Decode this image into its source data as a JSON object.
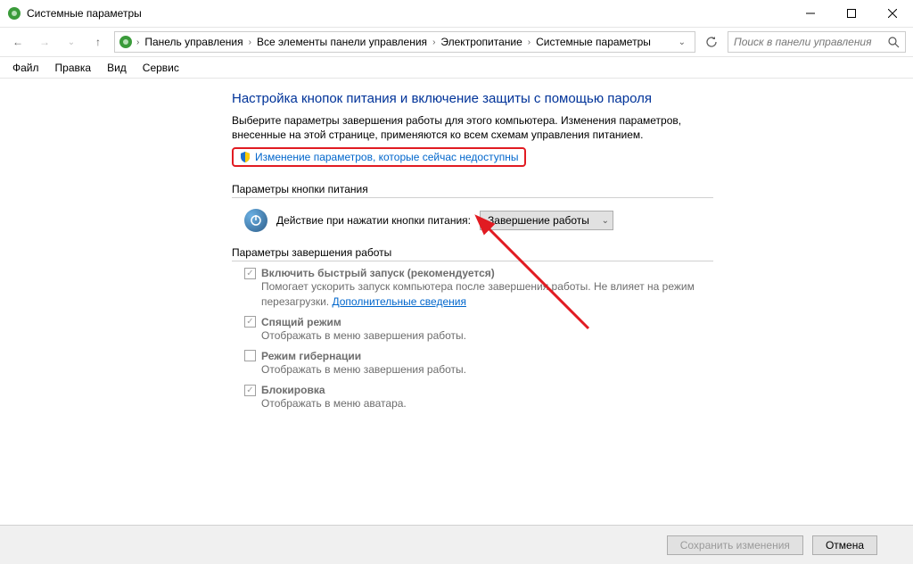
{
  "window": {
    "title": "Системные параметры"
  },
  "breadcrumb": {
    "items": [
      "Панель управления",
      "Все элементы панели управления",
      "Электропитание",
      "Системные параметры"
    ]
  },
  "search": {
    "placeholder": "Поиск в панели управления"
  },
  "menu": {
    "file": "Файл",
    "edit": "Правка",
    "view": "Вид",
    "service": "Сервис"
  },
  "page": {
    "heading": "Настройка кнопок питания и включение защиты с помощью пароля",
    "description": "Выберите параметры завершения работы для этого компьютера. Изменения параметров, внесенные на этой странице, применяются ко всем схемам управления питанием.",
    "change_link": "Изменение параметров, которые сейчас недоступны"
  },
  "power_button": {
    "section": "Параметры кнопки питания",
    "label": "Действие при нажатии кнопки питания:",
    "selected": "Завершение работы"
  },
  "shutdown": {
    "section": "Параметры завершения работы",
    "fast_start_label": "Включить быстрый запуск (рекомендуется)",
    "fast_start_desc": "Помогает ускорить запуск компьютера после завершения работы. Не влияет на режим перезагрузки. ",
    "learn_more": "Дополнительные сведения",
    "sleep_label": "Спящий режим",
    "sleep_desc": "Отображать в меню завершения работы.",
    "hibernate_label": "Режим гибернации",
    "hibernate_desc": "Отображать в меню завершения работы.",
    "lock_label": "Блокировка",
    "lock_desc": "Отображать в меню аватара."
  },
  "footer": {
    "save": "Сохранить изменения",
    "cancel": "Отмена"
  }
}
